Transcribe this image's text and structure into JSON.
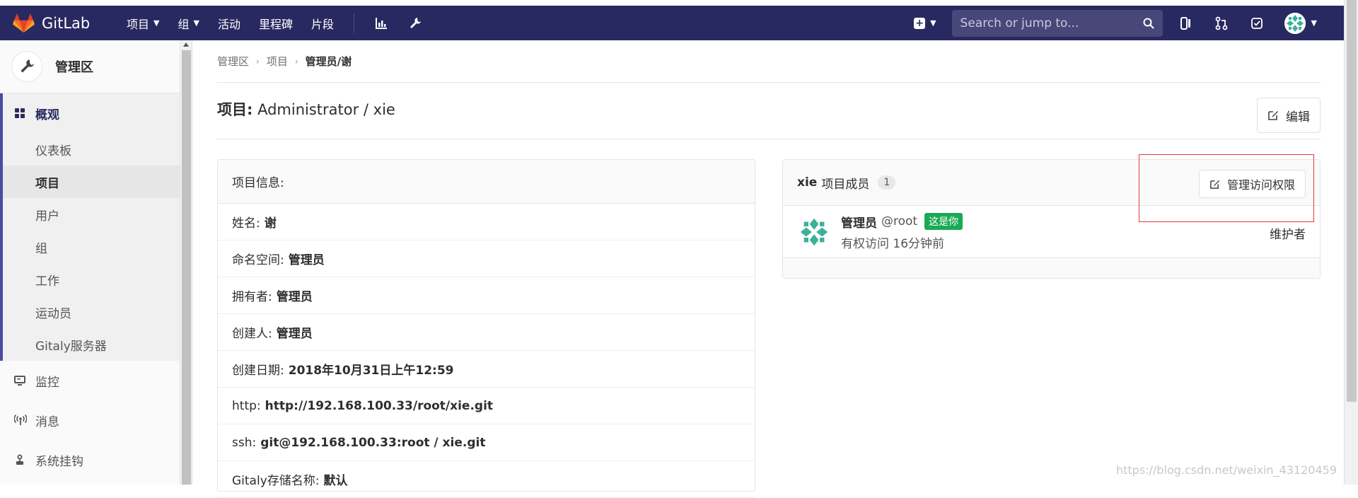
{
  "topbar": {
    "brand": "GitLab",
    "nav": [
      {
        "label": "项目",
        "caret": true
      },
      {
        "label": "组",
        "caret": true
      },
      {
        "label": "活动",
        "caret": false
      },
      {
        "label": "里程碑",
        "caret": false
      },
      {
        "label": "片段",
        "caret": false
      }
    ],
    "search_placeholder": "Search or jump to...",
    "colors": {
      "bg": "#292961",
      "search_bg": "#47477a"
    }
  },
  "sidebar": {
    "title": "管理区",
    "active_section": "概观",
    "sub_items": [
      "仪表板",
      "项目",
      "用户",
      "组",
      "工作",
      "运动员",
      "Gitaly服务器"
    ],
    "active_sub": "项目",
    "items": [
      "监控",
      "消息",
      "系统挂钩"
    ]
  },
  "breadcrumb": {
    "items": [
      "管理区",
      "项目",
      "管理员/谢"
    ]
  },
  "page": {
    "title_prefix": "项目:",
    "title": "Administrator / xie",
    "edit_label": "编辑"
  },
  "info_card": {
    "heading": "项目信息:",
    "rows": [
      {
        "label": "姓名:",
        "value": "谢"
      },
      {
        "label": "命名空间:",
        "value": "管理员"
      },
      {
        "label": "拥有者:",
        "value": "管理员"
      },
      {
        "label": "创建人:",
        "value": "管理员"
      },
      {
        "label": "创建日期:",
        "value": "2018年10月31日上午12:59"
      },
      {
        "label": "http:",
        "value": "http://192.168.100.33/root/xie.git"
      },
      {
        "label": "ssh:",
        "value": "git@192.168.100.33:root / xie.git"
      },
      {
        "label": "Gitaly存储名称:",
        "value": "默认"
      }
    ]
  },
  "members_card": {
    "project": "xie",
    "heading": "项目成员",
    "count": "1",
    "manage_label": "管理访问权限",
    "member": {
      "name": "管理员",
      "handle": "@root",
      "badge": "这是你",
      "access": "有权访问 16分钟前",
      "role": "维护者"
    },
    "badge_color": "#1aaa55"
  },
  "watermark": "https://blog.csdn.net/weixin_43120459"
}
